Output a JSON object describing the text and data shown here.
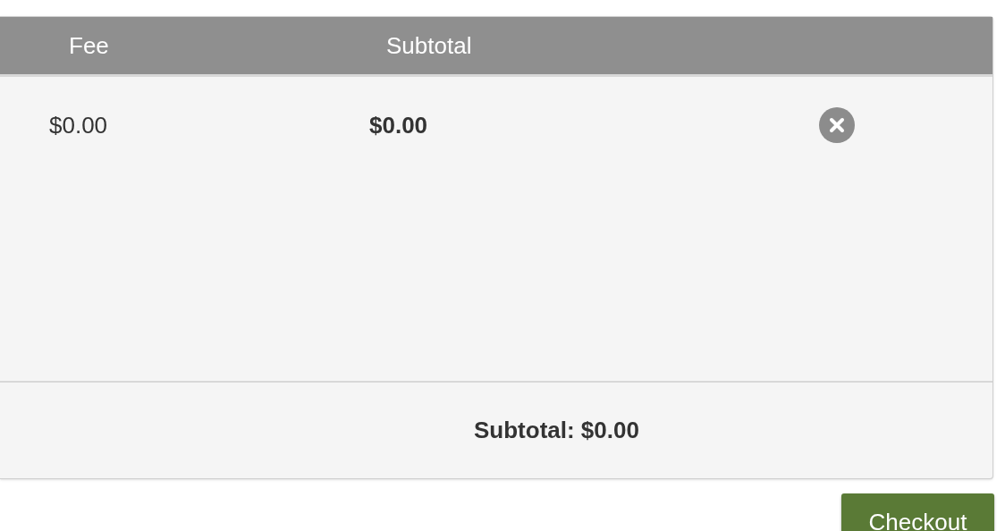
{
  "table": {
    "columns": [
      "Fee",
      "Subtotal"
    ],
    "rows": [
      {
        "fee": "$0.00",
        "subtotal": "$0.00"
      }
    ],
    "footer": "Subtotal: $0.00"
  },
  "buttons": [
    "Checkout"
  ]
}
